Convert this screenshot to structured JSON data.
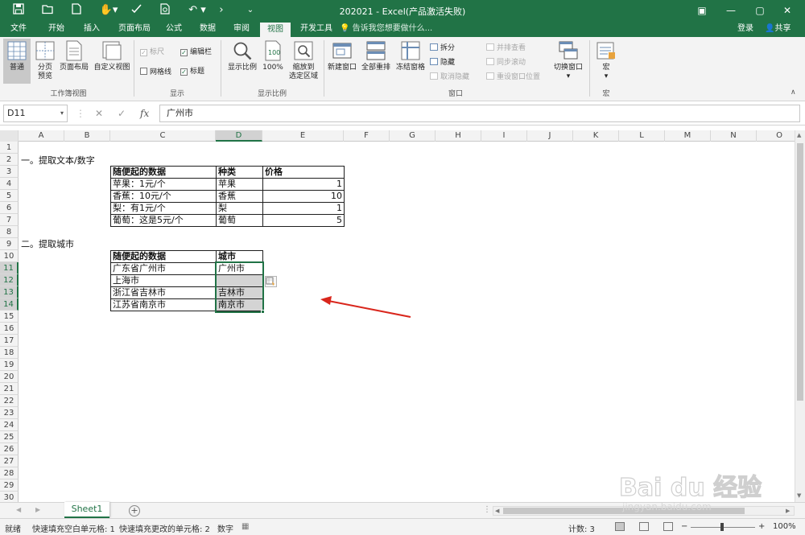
{
  "window": {
    "title": "202021 - Excel(产品激活失败)",
    "controls": [
      "▣",
      "—",
      "▢",
      "✕"
    ]
  },
  "ribbon_tabs": [
    {
      "label": "文件"
    },
    {
      "label": "开始"
    },
    {
      "label": "插入"
    },
    {
      "label": "页面布局"
    },
    {
      "label": "公式"
    },
    {
      "label": "数据"
    },
    {
      "label": "审阅"
    },
    {
      "label": "视图",
      "active": true
    },
    {
      "label": "开发工具"
    }
  ],
  "tell_me": "告诉我您想要做什么...",
  "account": {
    "login": "登录",
    "share": "共享"
  },
  "ribbon": {
    "workbook_views": {
      "label": "工作簿视图",
      "normal": "普通",
      "page_break": [
        "分页",
        "预览"
      ],
      "page_layout": "页面布局",
      "custom_views": "自定义视图"
    },
    "show": {
      "label": "显示",
      "ruler": "标尺",
      "formula_bar": "编辑栏",
      "gridlines": "网格线",
      "headings": "标题"
    },
    "zoom": {
      "label": "显示比例",
      "zoom": "显示比例",
      "zoom_100": "100%",
      "zoom_selection": [
        "缩放到",
        "选定区域"
      ]
    },
    "window": {
      "label": "窗口",
      "new_window": "新建窗口",
      "arrange_all": "全部重排",
      "freeze_panes": "冻结窗格",
      "split": "拆分",
      "hide": "隐藏",
      "unhide": "取消隐藏",
      "side_by_side": "并排查看",
      "sync_scroll": "同步滚动",
      "reset_position": "重设窗口位置",
      "switch_windows": "切换窗口"
    },
    "macros": {
      "label": "宏",
      "macros": "宏"
    }
  },
  "formula_bar": {
    "name_box": "D11",
    "content": "广州市"
  },
  "sheet": {
    "columns": [
      "A",
      "B",
      "C",
      "D",
      "E",
      "F",
      "G",
      "H",
      "I",
      "J",
      "K",
      "L",
      "M",
      "N",
      "O"
    ],
    "selected_column": "D",
    "rows": [
      "1",
      "2",
      "3",
      "4",
      "5",
      "6",
      "7",
      "8",
      "9",
      "10",
      "11",
      "12",
      "13",
      "14",
      "15",
      "16",
      "17",
      "18",
      "19",
      "20",
      "21",
      "22",
      "23",
      "24",
      "25",
      "26",
      "27",
      "28",
      "29",
      "30"
    ],
    "selected_rows": [
      "11",
      "12",
      "13",
      "14"
    ],
    "section1_title": "一。提取文本/数字",
    "table1": {
      "headers": [
        "随便起的数据",
        "种类",
        "价格"
      ],
      "rows": [
        [
          "苹果：1元/个",
          "苹果",
          "1"
        ],
        [
          "香蕉：10元/个",
          "香蕉",
          "10"
        ],
        [
          "梨：有1元/个",
          "梨",
          "1"
        ],
        [
          "葡萄：这是5元/个",
          "葡萄",
          "5"
        ]
      ]
    },
    "section2_title": "二。提取城市",
    "table2": {
      "headers": [
        "随便起的数据",
        "城市"
      ],
      "rows": [
        [
          "广东省广州市",
          "广州市"
        ],
        [
          "上海市",
          ""
        ],
        [
          "浙江省吉林市",
          "吉林市"
        ],
        [
          "江苏省南京市",
          "南京市"
        ]
      ]
    }
  },
  "sheet_tabs": [
    {
      "label": "Sheet1",
      "active": true
    }
  ],
  "status_bar": {
    "ready": "就绪",
    "flash_fill_blank": "快速填充空白单元格: 1",
    "flash_fill_changed": "快速填充更改的单元格: 2",
    "mode": "数字",
    "count": "计数: 3",
    "zoom": "100%"
  },
  "watermark": {
    "line1": "Bai du 经验",
    "line2": "jingyan.baidu.com"
  },
  "colors": {
    "accent": "#217346",
    "arrow": "#d9261c"
  }
}
